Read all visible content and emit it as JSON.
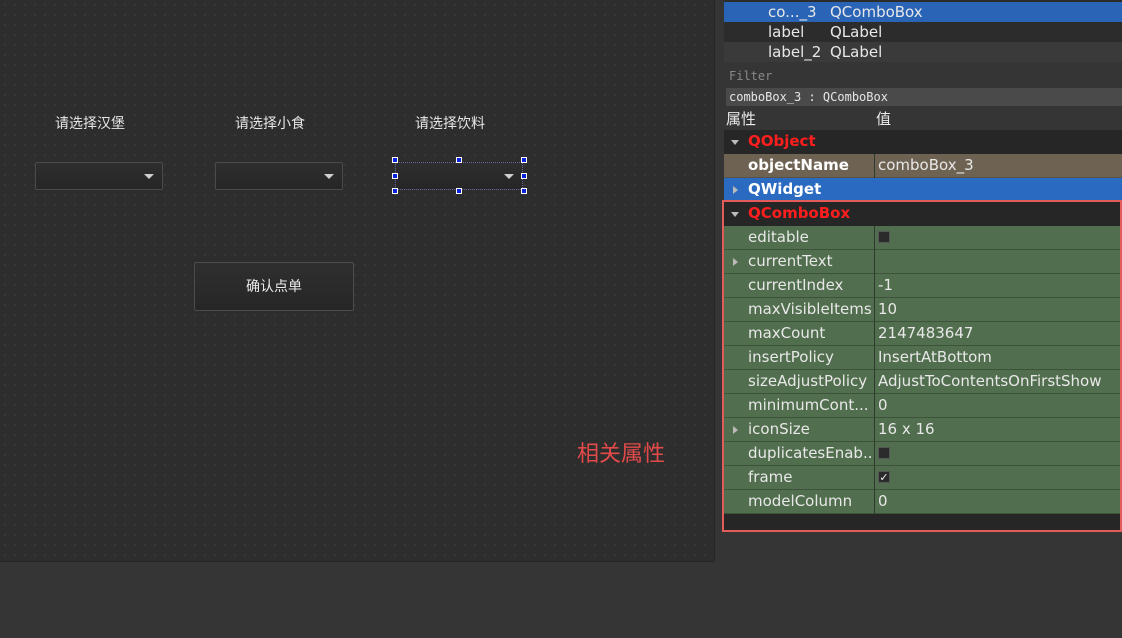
{
  "form": {
    "labels": [
      "请选择汉堡",
      "请选择小食",
      "请选择饮料"
    ],
    "confirm_button": "确认点单",
    "annotation": "相关属性"
  },
  "object_tree": {
    "rows": [
      {
        "name": "co..._3",
        "class": "QComboBox",
        "selected": true
      },
      {
        "name": "label",
        "class": "QLabel"
      },
      {
        "name": "label_2",
        "class": "QLabel"
      }
    ]
  },
  "filter_placeholder": "Filter",
  "object_class": "comboBox_3 : QComboBox",
  "property_header": {
    "property": "属性",
    "value": "值"
  },
  "property_groups": {
    "qobject": "QObject",
    "qwidget": "QWidget",
    "qcombobox": "QComboBox"
  },
  "object_name": {
    "name": "objectName",
    "value": "comboBox_3"
  },
  "properties": [
    {
      "name": "editable",
      "value": "",
      "type": "checkbox",
      "checked": false
    },
    {
      "name": "currentText",
      "value": "",
      "expandable": true
    },
    {
      "name": "currentIndex",
      "value": "-1"
    },
    {
      "name": "maxVisibleItems",
      "value": "10"
    },
    {
      "name": "maxCount",
      "value": "2147483647"
    },
    {
      "name": "insertPolicy",
      "value": "InsertAtBottom"
    },
    {
      "name": "sizeAdjustPolicy",
      "value": "AdjustToContentsOnFirstShow"
    },
    {
      "name": "minimumCont...",
      "value": "0"
    },
    {
      "name": "iconSize",
      "value": "16 x 16",
      "expandable": true
    },
    {
      "name": "duplicatesEnab...",
      "value": "",
      "type": "checkbox",
      "checked": false
    },
    {
      "name": "frame",
      "value": "✓",
      "type": "checkbox",
      "checked": true
    },
    {
      "name": "modelColumn",
      "value": "0"
    }
  ],
  "colors": {
    "selection_blue": "#2a64b6",
    "group_red": "#ff1e1e",
    "row_green": "#516e4e",
    "highlight_red": "#e35b5b"
  }
}
